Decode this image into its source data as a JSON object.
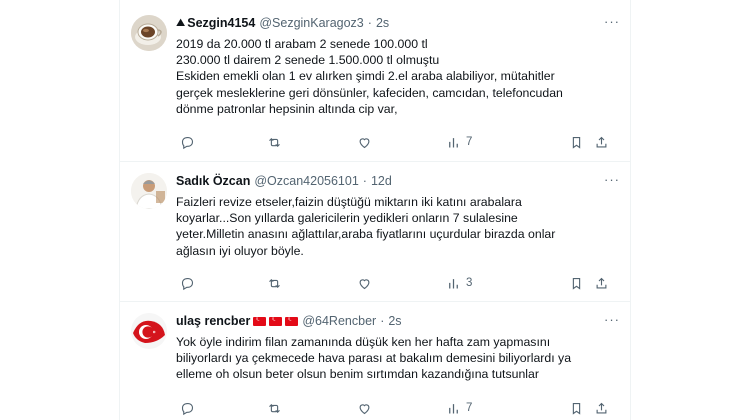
{
  "tweets": [
    {
      "name": "Sezgin4154",
      "handle": "@SezginKaragoz3",
      "dot": "·",
      "time": "2s",
      "lines": [
        "2019 da 20.000 tl arabam 2 senede 100.000 tl",
        "230.000 tl dairem 2 senede 1.500.000 tl olmuştu",
        "Eskiden emekli olan 1 ev alırken şimdi 2.el araba alabiliyor, mütahitler",
        "gerçek mesleklerine geri dönsünler, kafeciden, camcıdan, telefoncudan",
        "dönme patronlar hepsinin altında cip var,"
      ],
      "views": "7"
    },
    {
      "name": "Sadık Özcan",
      "handle": "@Ozcan42056101",
      "dot": "·",
      "time": "12d",
      "lines": [
        "Faizleri revize etseler,faizin düştüğü miktarın iki katını arabalara",
        "koyarlar...Son yıllarda galericilerin yedikleri onların 7 sulalesine",
        "yeter.Milletin anasını ağlattılar,araba fiyatlarını uçurdular birazda onlar",
        "ağlasın iyi oluyor böyle."
      ],
      "views": "3"
    },
    {
      "name": "ulaş rencber",
      "handle": "@64Rencber",
      "dot": "·",
      "time": "2s",
      "lines": [
        "Yok öyle indirim filan zamanında düşük ken her hafta zam yapmasını",
        "biliyorlardı ya çekmecede hava parası at bakalım demesini biliyorlardı ya",
        "elleme oh olsun beter olsun benim sırtımdan kazandığına tutsunlar"
      ],
      "views": "7"
    }
  ],
  "icons": {
    "reply": "reply-icon",
    "retweet": "retweet-icon",
    "like": "like-icon",
    "views": "views-icon",
    "bookmark": "bookmark-icon",
    "share": "share-icon",
    "more": "more-icon"
  },
  "colors": {
    "text": "#0f1419",
    "secondary": "#536471",
    "border": "#eff3f4",
    "flag": "#e30a17"
  }
}
